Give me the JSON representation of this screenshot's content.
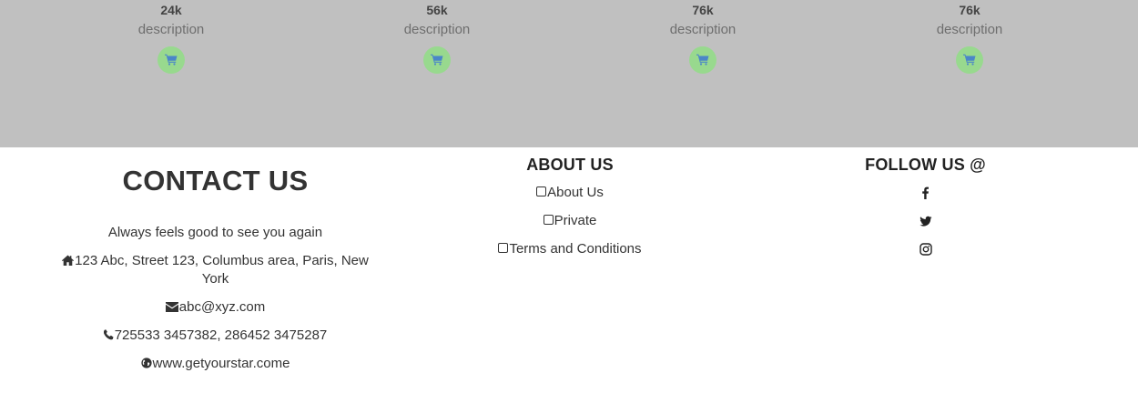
{
  "stats": [
    {
      "value": "24k",
      "description": "description",
      "icon": "shopping-cart-icon"
    },
    {
      "value": "56k",
      "description": "description",
      "icon": "shopping-cart-icon"
    },
    {
      "value": "76k",
      "description": "description",
      "icon": "shopping-cart-icon"
    },
    {
      "value": "76k",
      "description": "description",
      "icon": "shopping-cart-icon"
    }
  ],
  "contact": {
    "title": "CONTACT US",
    "tagline": "Always feels good to see you again",
    "address": "123 Abc, Street 123, Columbus area, Paris, New York",
    "email": "abc@xyz.com",
    "phone": "725533 3457382, 286452 3475287",
    "website": "www.getyourstar.come"
  },
  "about": {
    "title": "ABOUT US",
    "links": [
      "About Us",
      "Private",
      "Terms and Conditions"
    ]
  },
  "follow": {
    "title": "FOLLOW US @",
    "icons": [
      "facebook-icon",
      "twitter-icon",
      "instagram-icon"
    ]
  },
  "colors": {
    "band_bg": "#c0c0c0",
    "cart_circle": "#98d98e",
    "cart_icon": "#4a86c8",
    "text": "#333333"
  }
}
